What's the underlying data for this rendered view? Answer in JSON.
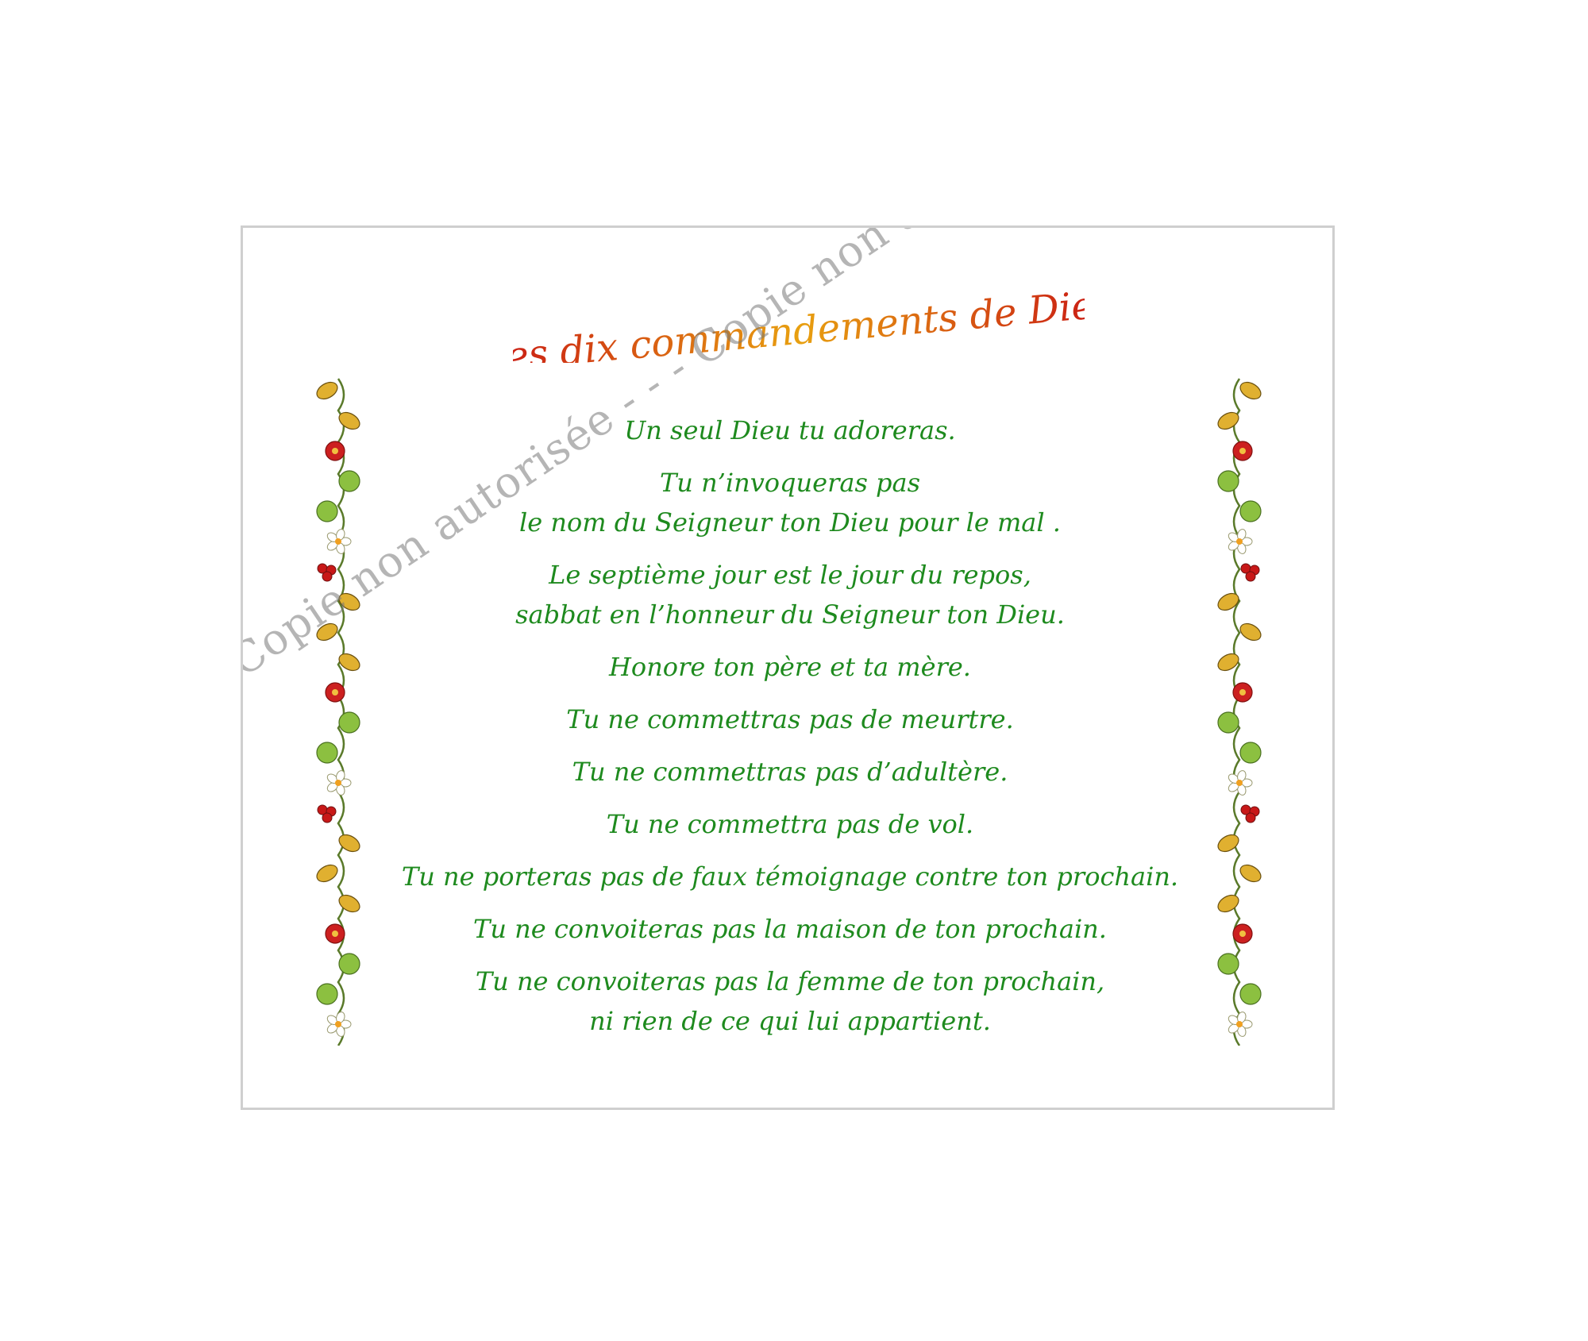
{
  "title": "Les dix commandements de Dieu",
  "commandments": [
    {
      "lines": [
        "Un seul Dieu tu adoreras."
      ]
    },
    {
      "lines": [
        "Tu n’invoqueras pas",
        "le nom du Seigneur ton Dieu pour le mal ."
      ]
    },
    {
      "lines": [
        "Le septième jour est le jour du repos,",
        "sabbat en l’honneur du Seigneur ton Dieu."
      ]
    },
    {
      "lines": [
        "Honore ton père et ta mère."
      ]
    },
    {
      "lines": [
        "Tu ne commettras pas de meurtre."
      ]
    },
    {
      "lines": [
        "Tu ne commettras pas d’adultère."
      ]
    },
    {
      "lines": [
        "Tu ne commettra pas de vol."
      ]
    },
    {
      "lines": [
        "Tu ne porteras pas de faux témoignage contre ton prochain."
      ]
    },
    {
      "lines": [
        "Tu ne convoiteras pas la maison de ton prochain."
      ]
    },
    {
      "lines": [
        "Tu ne convoiteras pas la femme de ton prochain,",
        "ni rien de ce qui lui appartient."
      ]
    }
  ],
  "watermark": "Copie non autorisée - - - Copie non autorisée - - - Copie non autorisée",
  "colors": {
    "title_start": "#c81414",
    "title_end": "#e89a10",
    "text": "#1e8a1e",
    "watermark": "#787878",
    "frame": "#cfcfcf"
  },
  "decorations": [
    "floral-vine-border-left",
    "floral-vine-border-right"
  ]
}
